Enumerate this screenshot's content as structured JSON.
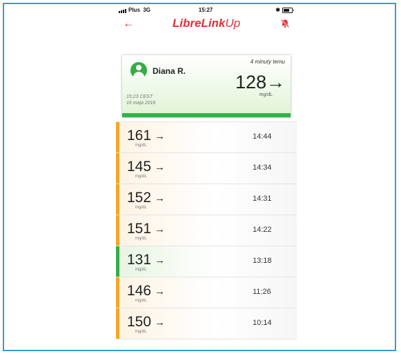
{
  "status_bar": {
    "carrier": "Plus",
    "network": "3G",
    "time": "15:27",
    "bluetooth": "✱"
  },
  "nav": {
    "back_icon": "←",
    "brand_main": "LibreLink",
    "brand_up": "Up",
    "alarm_icon": "bell-off-icon"
  },
  "patient": {
    "name": "Diana R.",
    "ago": "4 minuty temu",
    "value": "128",
    "arrow": "→",
    "unit": "mg/dL",
    "time": "15:23 CEST",
    "date": "16 maja 2018",
    "status_color": "#32b34a"
  },
  "readings": [
    {
      "value": "161",
      "arrow": "→",
      "unit": "mg/dL",
      "time": "14:44",
      "status": "orange"
    },
    {
      "value": "145",
      "arrow": "→",
      "unit": "mg/dL",
      "time": "14:34",
      "status": "orange"
    },
    {
      "value": "152",
      "arrow": "→",
      "unit": "mg/dL",
      "time": "14:31",
      "status": "orange"
    },
    {
      "value": "151",
      "arrow": "→",
      "unit": "mg/dL",
      "time": "14:22",
      "status": "orange"
    },
    {
      "value": "131",
      "arrow": "→",
      "unit": "mg/dL",
      "time": "13:18",
      "status": "green"
    },
    {
      "value": "146",
      "arrow": "→",
      "unit": "mg/dL",
      "time": "11:26",
      "status": "orange"
    },
    {
      "value": "150",
      "arrow": "→",
      "unit": "mg/dL",
      "time": "10:14",
      "status": "orange"
    }
  ],
  "colors": {
    "brand": "#e0303a",
    "in_range": "#34ad45",
    "high": "#f5a623",
    "frame": "#2f9fd6"
  }
}
